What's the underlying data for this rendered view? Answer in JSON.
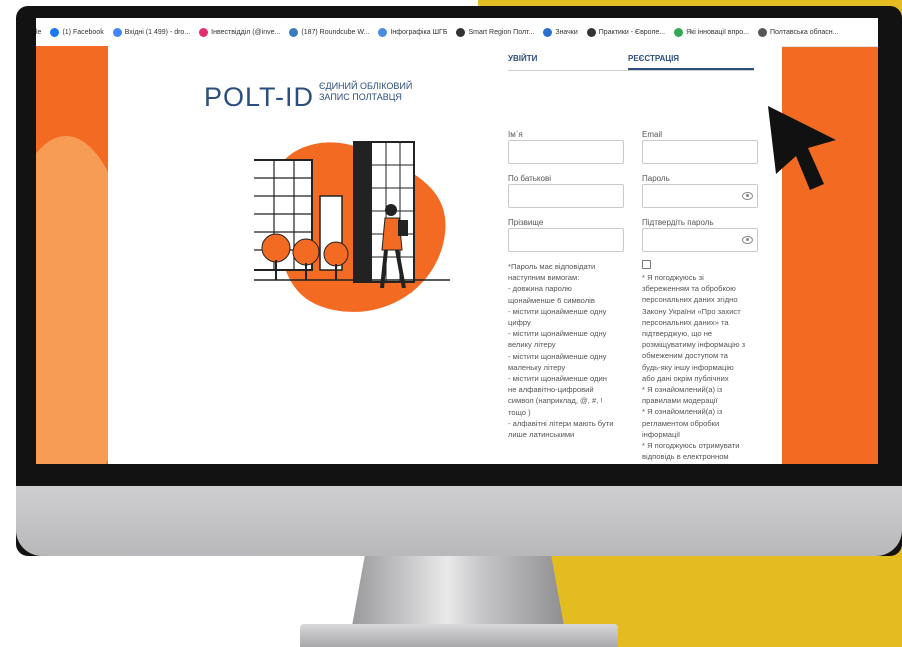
{
  "bookmarks": [
    {
      "label": "le",
      "icon": "none"
    },
    {
      "label": "(1) Facebook",
      "icon": "facebook-icon",
      "color": "#1877f2"
    },
    {
      "label": "Вхідні (1 499) - dro...",
      "icon": "google-icon",
      "color": "#4285f4"
    },
    {
      "label": "Інвествідділ (@inve...",
      "icon": "instagram-icon",
      "color": "#e1306c"
    },
    {
      "label": "(187) Roundcube W...",
      "icon": "roundcube-icon",
      "color": "#3a7bbf"
    },
    {
      "label": "Інфографіка ШГБ",
      "icon": "doc-icon",
      "color": "#4a8cdf"
    },
    {
      "label": "Smart Region Полт...",
      "icon": "globe-icon",
      "color": "#333333"
    },
    {
      "label": "Значки",
      "icon": "figures-icon",
      "color": "#2a6fd0"
    },
    {
      "label": "Практики - Європе...",
      "icon": "globe-icon",
      "color": "#333333"
    },
    {
      "label": "Які інновації впро...",
      "icon": "apps-icon",
      "color": "#34a853"
    },
    {
      "label": "Полтавська обласн...",
      "icon": "site-icon",
      "color": "#555555"
    }
  ],
  "logo": {
    "main": "POLT-ID",
    "sub_line1": "ЄДИНИЙ ОБЛІКОВИЙ",
    "sub_line2": "ЗАПИС ПОЛТАВЦЯ"
  },
  "tabs": {
    "login": "УВІЙТИ",
    "register": "РЕЄСТРАЦІЯ"
  },
  "form": {
    "first_name": {
      "label": "Ім`я",
      "value": ""
    },
    "email": {
      "label": "Email",
      "value": ""
    },
    "patronymic": {
      "label": "По батькові",
      "value": ""
    },
    "password": {
      "label": "Пароль",
      "value": ""
    },
    "surname": {
      "label": "Прізвище",
      "value": ""
    },
    "password_confirm": {
      "label": "Підтвердіть пароль",
      "value": ""
    }
  },
  "password_rules": [
    "*Пароль має відповідати",
    "наступним вимогам:",
    "- довжина паролю",
    "щонайменше 6 символів",
    "- містити щонайменше одну",
    "цифру",
    "- містити щонайменше одну",
    "велику літеру",
    "- містити щонайменше одну",
    "маленьку літеру",
    "- містити щонайменше один",
    "не алфавітно-цифровий",
    "символ (наприклад, @, #, !",
    "тощо )",
    "- алфавітні літери мають бути",
    "лише латинськими"
  ],
  "consent": {
    "checked": false,
    "lines": [
      "* Я погоджуюсь зі",
      "збереженням та обробкою",
      "персональних даних згідно",
      "Закону України «Про захист",
      "персональних даних» та",
      "підтверджую, що не",
      "розміщуватиму інформацію з",
      "обмеженим доступом та",
      "будь-яку іншу інформацію",
      "або дані окрім публічних",
      "* Я ознайомлений(а) із",
      "правилами модерації",
      "* Я ознайомлений(а) із",
      "регламентом обробки",
      "інформації",
      "* Я погоджуюсь отримувати",
      "відповідь в електронном"
    ]
  },
  "colors": {
    "accent": "#2b4f7c",
    "orange": "#f36b22",
    "yellow": "#e3bc22"
  }
}
